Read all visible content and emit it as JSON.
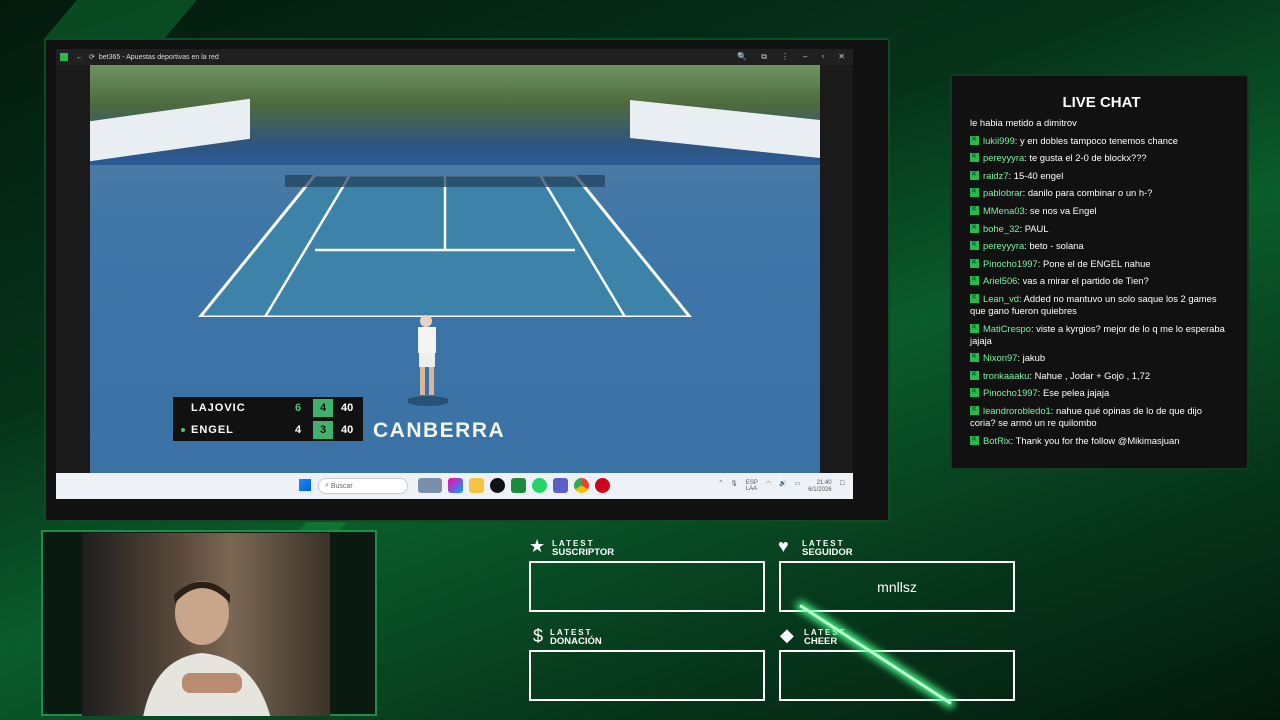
{
  "browser": {
    "tab_title": "bet365 - Apuestas deportivas en la red",
    "taskbar_search": "Buscar",
    "tray_lang": "ESP\nLAA",
    "tray_time": "21:40",
    "tray_date": "6/1/2026"
  },
  "broadcast": {
    "venue": "CANBERRA",
    "players": [
      {
        "name": "LAJOVIC",
        "set1": "6",
        "set2": "4",
        "points": "40"
      },
      {
        "name": "ENGEL",
        "set1": "4",
        "set2": "3",
        "points": "40"
      }
    ]
  },
  "chat": {
    "title": "LIVE CHAT",
    "messages": [
      {
        "user": "",
        "text": "le habia metido a dimitrov"
      },
      {
        "user": "lukii999",
        "text": " y en dobles tampoco tenemos chance"
      },
      {
        "user": "pereyyyra",
        "text": " te gusta el 2-0 de blockx???"
      },
      {
        "user": "raidz7",
        "text": " 15-40 engel"
      },
      {
        "user": "pablobrar",
        "text": " danilo para combinar o un h-?"
      },
      {
        "user": "MMena03",
        "text": " se nos va Engel"
      },
      {
        "user": "bohe_32",
        "text": " PAUL"
      },
      {
        "user": "pereyyyra",
        "text": " beto - solana"
      },
      {
        "user": "Pinocho1997",
        "text": " Pone el de ENGEL nahue"
      },
      {
        "user": "Ariel506",
        "text": " vas a mirar el partido de Tien?"
      },
      {
        "user": "Lean_vd",
        "text": " Added no mantuvo un solo saque los 2 games que gano fueron quiebres"
      },
      {
        "user": "MatiCrespo",
        "text": " viste a kyrgios? mejor de lo q me lo esperaba jajaja"
      },
      {
        "user": "Nixon97",
        "text": " jakub"
      },
      {
        "user": "tronkaaaku",
        "text": " Nahue , Jodar + Gojo , 1,72"
      },
      {
        "user": "Pinocho1997",
        "text": " Ese pelea jajaja"
      },
      {
        "user": "leandrorobledo1",
        "text": " nahue qué opinas de lo de que dijo coria? se armó un re quilombo"
      },
      {
        "user": "BotRix",
        "text": " Thank you for the follow @Mikimasjuan"
      }
    ]
  },
  "alerts": {
    "latest_word": "LATEST",
    "suscriptor": {
      "kind": "SUSCRIPTOR",
      "value": ""
    },
    "seguidor": {
      "kind": "SEGUIDOR",
      "value": "mnllsz"
    },
    "donacion": {
      "kind": "DONACIÓN",
      "value": ""
    },
    "cheer": {
      "kind": "CHEER",
      "value": ""
    }
  }
}
